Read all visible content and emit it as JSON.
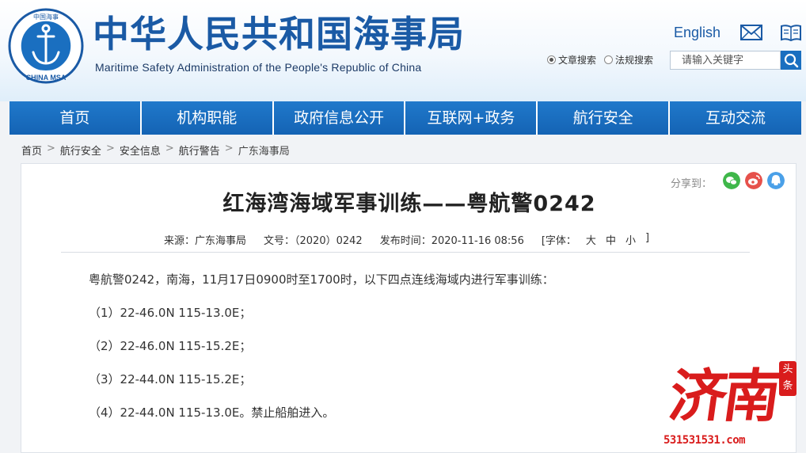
{
  "header": {
    "logo_top_text": "中国海事",
    "logo_bottom_text": "CHINA MSA",
    "title": "中华人民共和国海事局",
    "subtitle": "Maritime Safety Administration of the People's Republic of China",
    "english_link": "English",
    "search": {
      "radio_article": "文章搜索",
      "radio_law": "法规搜索",
      "selected": "文章搜索",
      "placeholder": "请输入关键字",
      "value": ""
    }
  },
  "nav": {
    "items": [
      {
        "label": "首页"
      },
      {
        "label": "机构职能"
      },
      {
        "label": "政府信息公开"
      },
      {
        "label": "互联网+政务"
      },
      {
        "label": "航行安全"
      },
      {
        "label": "互动交流"
      }
    ]
  },
  "breadcrumb": {
    "items": [
      "首页",
      "航行安全",
      "安全信息",
      "航行警告",
      "广东海事局"
    ],
    "separator": ">"
  },
  "article": {
    "share_label": "分享到：",
    "title": "红海湾海域军事训练——粤航警0242",
    "source": "来源：广东海事局",
    "doc_no": "文号：（2020）0242",
    "published": "发布时间：2020-11-16 08:56",
    "font_size_open": "[字体：",
    "font_large": "大",
    "font_medium": "中",
    "font_small": "小",
    "font_size_close": "]",
    "paragraphs": [
      "粤航警0242，南海，11月17日0900时至1700时，以下四点连线海域内进行军事训练：",
      "（1）22-46.0N 115-13.0E；",
      "（2）22-46.0N 115-15.2E；",
      "（3）22-44.0N 115-15.2E；",
      "（4）22-44.0N 115-13.0E。禁止船舶进入。"
    ]
  },
  "watermark": {
    "text": "济南",
    "seal": "头条",
    "url": "531531531.com"
  },
  "colors": {
    "brand_blue": "#1a6fc0",
    "title_blue": "#1a5aa5",
    "wechat_green": "#3fb74a",
    "weibo_red": "#e6514b",
    "qq_blue": "#4aa0e8",
    "watermark_red": "#d91c1c"
  },
  "icons": {
    "logo": "anchor-emblem-icon",
    "mail": "mail-icon",
    "book": "book-icon",
    "search": "search-icon",
    "wechat": "wechat-icon",
    "weibo": "weibo-icon",
    "qq": "qq-icon"
  }
}
